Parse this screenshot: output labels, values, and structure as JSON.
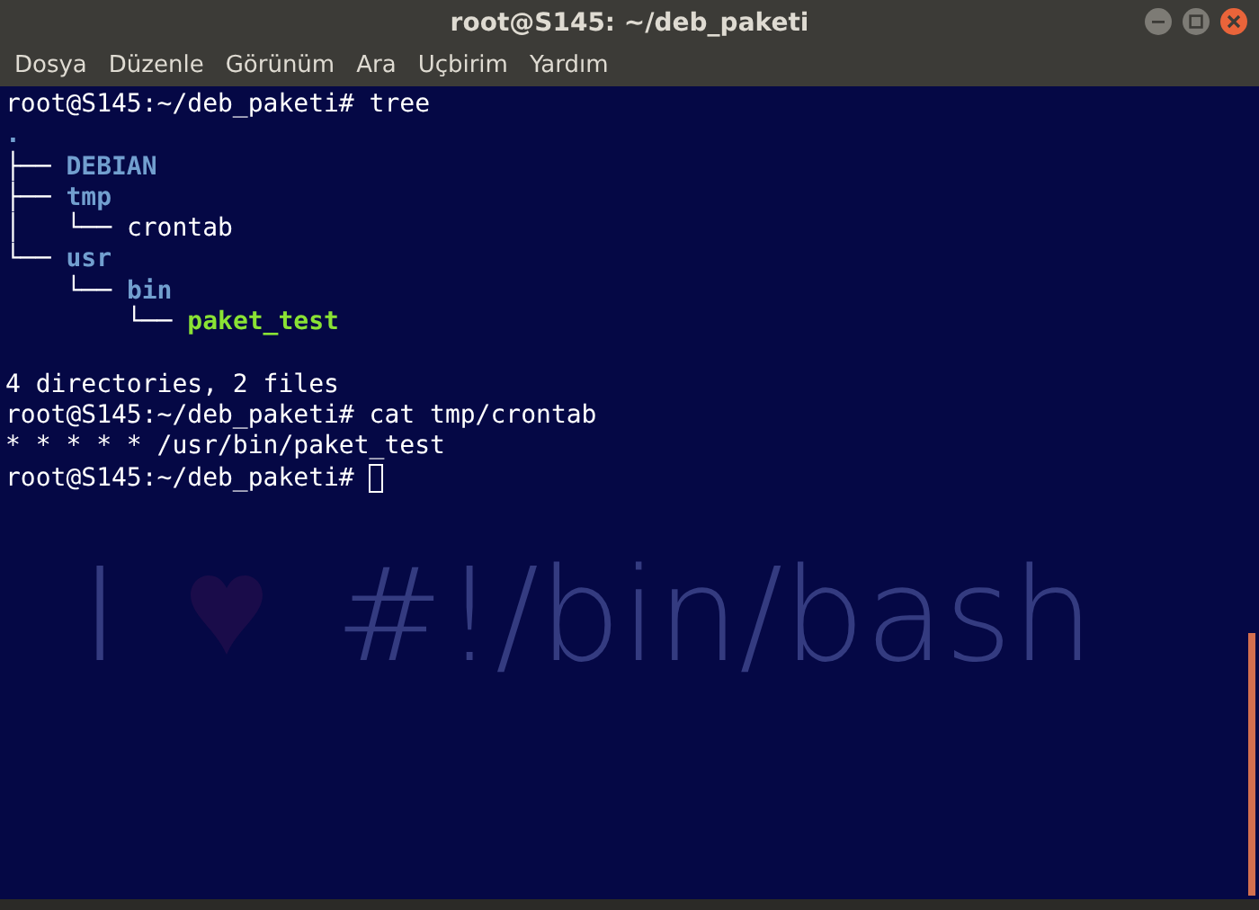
{
  "window": {
    "title": "root@S145: ~/deb_paketi"
  },
  "menu": [
    "Dosya",
    "Düzenle",
    "Görünüm",
    "Ara",
    "Uçbirim",
    "Yardım"
  ],
  "terminal": {
    "lines": [
      {
        "segments": [
          {
            "kind": "prompt",
            "text": "root@S145:~/deb_paketi# "
          },
          {
            "kind": "plain",
            "text": "tree"
          }
        ]
      },
      {
        "segments": [
          {
            "kind": "dir",
            "text": "."
          }
        ]
      },
      {
        "segments": [
          {
            "kind": "tree",
            "text": "├── "
          },
          {
            "kind": "dir",
            "text": "DEBIAN"
          }
        ]
      },
      {
        "segments": [
          {
            "kind": "tree",
            "text": "├── "
          },
          {
            "kind": "dir",
            "text": "tmp"
          }
        ]
      },
      {
        "segments": [
          {
            "kind": "tree",
            "text": "│   └── "
          },
          {
            "kind": "plain",
            "text": "crontab"
          }
        ]
      },
      {
        "segments": [
          {
            "kind": "tree",
            "text": "└── "
          },
          {
            "kind": "dir",
            "text": "usr"
          }
        ]
      },
      {
        "segments": [
          {
            "kind": "tree",
            "text": "    └── "
          },
          {
            "kind": "dir",
            "text": "bin"
          }
        ]
      },
      {
        "segments": [
          {
            "kind": "tree",
            "text": "        └── "
          },
          {
            "kind": "exec",
            "text": "paket_test"
          }
        ]
      },
      {
        "segments": [
          {
            "kind": "plain",
            "text": "4 directories, 2 files"
          }
        ],
        "blank_before": true
      },
      {
        "segments": [
          {
            "kind": "prompt",
            "text": "root@S145:~/deb_paketi# "
          },
          {
            "kind": "plain",
            "text": "cat tmp/crontab"
          }
        ]
      },
      {
        "segments": [
          {
            "kind": "plain",
            "text": "* * * * * /usr/bin/paket_test"
          }
        ]
      },
      {
        "segments": [
          {
            "kind": "prompt",
            "text": "root@S145:~/deb_paketi# "
          }
        ],
        "cursor": true
      }
    ],
    "background": {
      "text_1": "I",
      "text_2": "#!/bin/bash"
    }
  }
}
